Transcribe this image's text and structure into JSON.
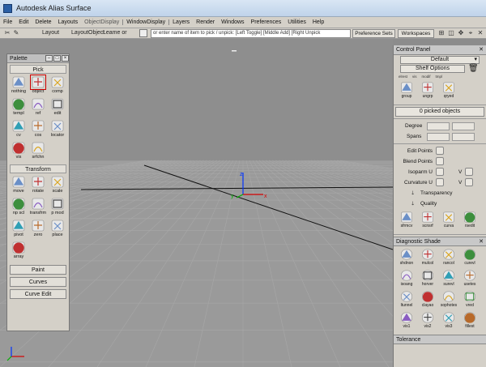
{
  "window": {
    "title": "Autodesk Alias Surface"
  },
  "menu": [
    "File",
    "Edit",
    "Delete",
    "Layouts",
    "ObjectDisplay",
    "WindowDisplay",
    "Layers",
    "Render",
    "Windows",
    "Preferences",
    "Utilities",
    "Help"
  ],
  "toolbar": {
    "shelf_tab_1": "Layout",
    "shelf_tab_2": "LayoutObject",
    "layer_field": "Leame or",
    "pick_prompt": "or enter name of item to pick / unpick: [Left Toggle] [Middle Add] [Right Unpick",
    "pref_sets": "Preference Sets",
    "workspaces": "Workspaces"
  },
  "palette": {
    "title": "Palette",
    "sections": {
      "pick": "Pick",
      "transform": "Transform"
    },
    "pick_tools": [
      {
        "label": "nothing",
        "icon": "pick-nothing-icon"
      },
      {
        "label": "object",
        "icon": "pick-object-icon",
        "selected": true
      },
      {
        "label": "comp",
        "icon": "pick-component-icon"
      },
      {
        "label": "templ",
        "icon": "pick-template-icon"
      },
      {
        "label": "ref",
        "icon": "pick-reference-icon"
      },
      {
        "label": "edit",
        "icon": "pick-edit-icon"
      },
      {
        "label": "cv",
        "icon": "pick-cv-icon"
      },
      {
        "label": "cos",
        "icon": "pick-cos-icon"
      },
      {
        "label": "locator",
        "icon": "pick-locator-icon"
      },
      {
        "label": "vis",
        "icon": "pick-visible-icon"
      },
      {
        "label": "srfchn",
        "icon": "pick-surface-chain-icon"
      }
    ],
    "transform_tools": [
      {
        "label": "move",
        "icon": "move-icon"
      },
      {
        "label": "rotate",
        "icon": "rotate-icon"
      },
      {
        "label": "scale",
        "icon": "scale-icon"
      },
      {
        "label": "np scl",
        "icon": "nonprop-scale-icon"
      },
      {
        "label": "transfrm",
        "icon": "transform-icon"
      },
      {
        "label": "p mod",
        "icon": "pivot-modify-icon"
      },
      {
        "label": "pivot",
        "icon": "pivot-icon"
      },
      {
        "label": "zero",
        "icon": "zero-transform-icon"
      },
      {
        "label": "place",
        "icon": "place-icon"
      },
      {
        "label": "array",
        "icon": "array-icon"
      }
    ],
    "buttons": [
      "Paint",
      "Curves",
      "Curve Edit"
    ]
  },
  "control_panel": {
    "title": "Control Panel",
    "workspace_dropdown": "Default",
    "shelf_dropdown": "Shelf Options",
    "shelf_partial_labels": [
      "elrest",
      "vis",
      "modif",
      "tmpl"
    ],
    "shelf_tools": [
      {
        "label": "group",
        "icon": "group-icon"
      },
      {
        "label": "ungrp",
        "icon": "ungroup-icon"
      },
      {
        "label": "qryed",
        "icon": "query-edit-icon"
      }
    ],
    "picked_status": "0 picked objects",
    "degree_label": "Degree",
    "spans_label": "Spans",
    "toggles": [
      "Edit Points",
      "Blend Points"
    ],
    "isoparm_label": "Isoparm U",
    "curvature_label": "Curvature U",
    "v_label": "V",
    "transparency_label": "Transparency",
    "quality_label": "Quality",
    "surface_tools": [
      {
        "label": "sfrmcv",
        "icon": "surface-from-curve-icon"
      },
      {
        "label": "scnsrf",
        "icon": "scan-surface-icon"
      },
      {
        "label": "curva",
        "icon": "curvature-icon"
      },
      {
        "label": "rsedit",
        "icon": "rsedit-icon"
      }
    ],
    "diag_title": "Diagnostic Shade",
    "diag_tools": [
      {
        "label": "shdnon",
        "icon": "shade-off-icon"
      },
      {
        "label": "mulcol",
        "icon": "multi-color-icon"
      },
      {
        "label": "rancol",
        "icon": "random-color-icon"
      },
      {
        "label": "curevl",
        "icon": "curvature-eval-icon"
      },
      {
        "label": "isoang",
        "icon": "isoangle-icon"
      },
      {
        "label": "horver",
        "icon": "horizontal-vertical-icon"
      },
      {
        "label": "surevl",
        "icon": "surface-eval-icon"
      },
      {
        "label": "usetes",
        "icon": "use-tessellation-icon"
      },
      {
        "label": "ltunnel",
        "icon": "light-tunnel-icon"
      },
      {
        "label": "clayao",
        "icon": "clay-ao-icon"
      },
      {
        "label": "sophotes",
        "icon": "isophotes-icon"
      },
      {
        "label": "vred",
        "icon": "vred-icon"
      },
      {
        "label": "vis1",
        "icon": "vis1-icon"
      },
      {
        "label": "vis2",
        "icon": "vis2-icon"
      },
      {
        "label": "vis3",
        "icon": "vis3-icon"
      },
      {
        "label": "fillest",
        "icon": "fill-estimate-icon"
      }
    ],
    "tolerance_label": "Tolerance"
  },
  "colors": {
    "viewport_bg": "#8e8e8e",
    "grid_line": "#a6a6a6",
    "axis_x": "#d40000",
    "axis_y": "#00b000",
    "axis_z": "#0033ff",
    "panel_bg": "#d4d0c8",
    "selection_outline": "#cc0000"
  }
}
